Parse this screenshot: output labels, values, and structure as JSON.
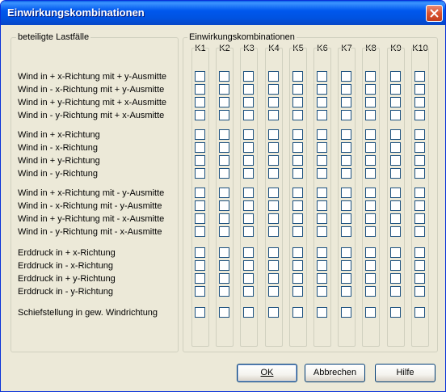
{
  "window": {
    "title": "Einwirkungskombinationen"
  },
  "left_group": {
    "legend": "beteiligte Lastfälle",
    "rows": [
      "Wind in + x-Richtung mit + y-Ausmitte",
      "Wind in - x-Richtung mit + y-Ausmitte",
      "Wind in + y-Richtung mit + x-Ausmitte",
      "Wind in - y-Richtung mit + x-Ausmitte",
      "Wind in + x-Richtung",
      "Wind in - x-Richtung",
      "Wind in + y-Richtung",
      "Wind in - y-Richtung",
      "Wind in + x-Richtung mit - y-Ausmitte",
      "Wind in - x-Richtung mit - y-Ausmitte",
      "Wind in + y-Richtung mit - x-Ausmitte",
      "Wind in - y-Richtung mit - x-Ausmitte",
      "Erddruck in + x-Richtung",
      "Erddruck in - x-Richtung",
      "Erddruck in + y-Richtung",
      "Erddruck in - y-Richtung",
      "Schiefstellung in gew. Windrichtung"
    ]
  },
  "right_group": {
    "legend": "Einwirkungskombinationen",
    "columns": [
      "K1",
      "K2",
      "K3",
      "K4",
      "K5",
      "K6",
      "K7",
      "K8",
      "K9",
      "K10"
    ]
  },
  "checked": [],
  "buttons": {
    "ok": "OK",
    "cancel": "Abbrechen",
    "help": "Hilfe"
  },
  "colors": {
    "title_bar": "#0054E3",
    "face": "#ECE9D8",
    "close": "#D9522F"
  }
}
